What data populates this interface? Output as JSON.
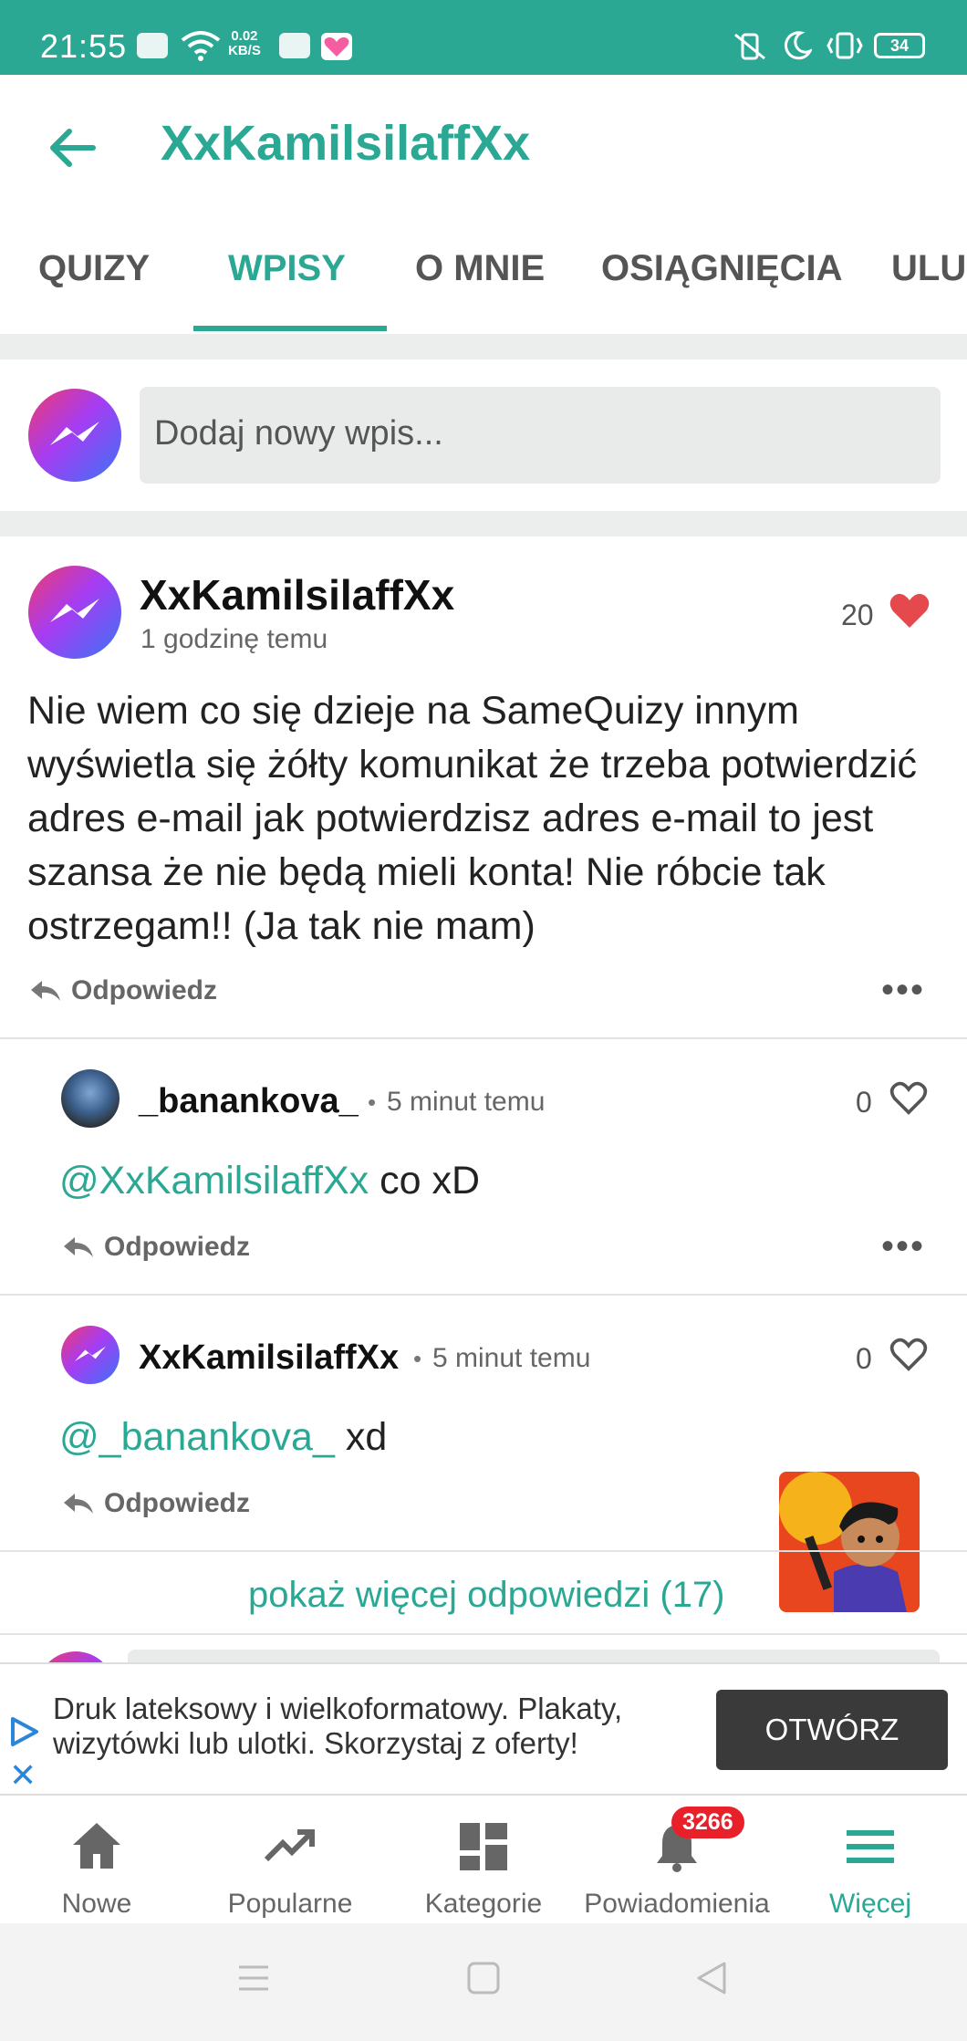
{
  "status_bar": {
    "time": "21:55",
    "net_speed_value": "0.02",
    "net_speed_unit": "KB/S",
    "battery": "34"
  },
  "header": {
    "title": "XxKamilsilaffXx",
    "back_icon": "arrow-left-icon"
  },
  "tabs": [
    {
      "label": "QUIZY"
    },
    {
      "label": "WPISY",
      "active": true
    },
    {
      "label": "O MNIE"
    },
    {
      "label": "OSIĄGNIĘCIA"
    },
    {
      "label": "ULU"
    }
  ],
  "new_post": {
    "placeholder": "Dodaj nowy wpis..."
  },
  "post": {
    "author": "XxKamilsilaffXx",
    "time": "1 godzinę temu",
    "likes": "20",
    "liked": true,
    "body": "Nie wiem co się dzieje na SameQuizy innym wyświetla się żółty komunikat że trzeba potwierdzić adres e-mail jak potwierdzisz adres e-mail to jest szansa że nie będą mieli konta! Nie róbcie tak ostrzegam!! (Ja tak nie mam)",
    "reply_label": "Odpowiedz",
    "more_label": "•••"
  },
  "comments": [
    {
      "author": "_banankova_",
      "separator": "•",
      "time": "5 minut temu",
      "likes": "0",
      "mention": "@XxKamilsilaffXx",
      "text": " co xD",
      "reply_label": "Odpowiedz",
      "more_label": "•••"
    },
    {
      "author": "XxKamilsilaffXx",
      "separator": "•",
      "time": "5 minut temu",
      "likes": "0",
      "mention": "@_banankova_",
      "text": " xd",
      "reply_label": "Odpowiedz"
    }
  ],
  "show_more_replies": "pokaż więcej odpowiedzi (17)",
  "ad": {
    "text": "Druk lateksowy i wielkoformatowy. Plakaty, wizytówki lub ulotki. Skorzystaj z oferty!",
    "button": "OTWÓRZ",
    "close": "✕"
  },
  "bottom_nav": [
    {
      "label": "Nowe",
      "icon": "home-icon"
    },
    {
      "label": "Popularne",
      "icon": "trending-icon"
    },
    {
      "label": "Kategorie",
      "icon": "grid-icon"
    },
    {
      "label": "Powiadomienia",
      "icon": "bell-icon",
      "badge": "3266"
    },
    {
      "label": "Więcej",
      "icon": "menu-icon",
      "active": true
    }
  ],
  "colors": {
    "accent": "#2aa894",
    "heart": "#e5484d",
    "badge": "#e8202a"
  }
}
